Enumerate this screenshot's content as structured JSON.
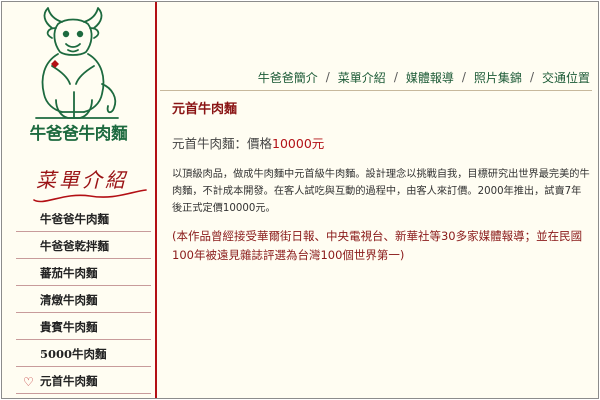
{
  "brand": {
    "name": "牛爸爸牛肉麵",
    "colors": {
      "green": "#1d6a3f",
      "red": "#b30f14",
      "background": "#fffdf2"
    }
  },
  "sidebar": {
    "section_title": "菜單介紹",
    "items": [
      {
        "label": "牛爸爸牛肉麵",
        "active": false
      },
      {
        "label": "牛爸爸乾拌麵",
        "active": false
      },
      {
        "label": "蕃茄牛肉麵",
        "active": false
      },
      {
        "label": "清燉牛肉麵",
        "active": false
      },
      {
        "label": "貴賓牛肉麵",
        "active": false
      },
      {
        "label": "5000牛肉麵",
        "active": false
      },
      {
        "label": "元首牛肉麵",
        "active": true
      }
    ]
  },
  "nav": {
    "items": [
      "牛爸爸簡介",
      "菜單介紹",
      "媒體報導",
      "照片集錦",
      "交通位置"
    ],
    "separator": "/"
  },
  "content": {
    "title": "元首牛肉麵",
    "price_prefix": "元首牛肉麵：價格",
    "price_value": "10000元",
    "description": "以頂級肉品，做成牛肉麵中元首級牛肉麵。設計理念以挑戰自我，目標研究出世界最完美的牛肉麵，不計成本開發。在客人試吃與互動的過程中，由客人來訂價。2000年推出，試賣7年後正式定價10000元。",
    "press": "(本作品曾經接受華爾街日報、中央電視台、新華社等30多家媒體報導；並在民國100年被遠見雜誌評選為台灣100個世界第一)"
  }
}
